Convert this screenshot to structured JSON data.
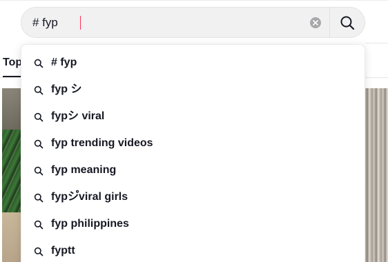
{
  "search": {
    "query": "# fyp",
    "clear_icon": "clear-x-icon",
    "submit_icon": "search-icon"
  },
  "tabs": {
    "active_label": "Top"
  },
  "suggestions": [
    {
      "label": "# fyp",
      "icon": "search-icon"
    },
    {
      "label": "fyp シ",
      "icon": "search-icon"
    },
    {
      "label": "fypシ viral",
      "icon": "search-icon"
    },
    {
      "label": "fyp trending videos",
      "icon": "search-icon"
    },
    {
      "label": "fyp meaning",
      "icon": "search-icon"
    },
    {
      "label": "fypシ゚viral girls",
      "icon": "search-icon"
    },
    {
      "label": "fyp philippines",
      "icon": "search-icon"
    },
    {
      "label": "fyptt",
      "icon": "search-icon"
    }
  ],
  "colors": {
    "text": "#161823",
    "caret": "#fe2c55",
    "search_bg": "#f1f1f2"
  }
}
